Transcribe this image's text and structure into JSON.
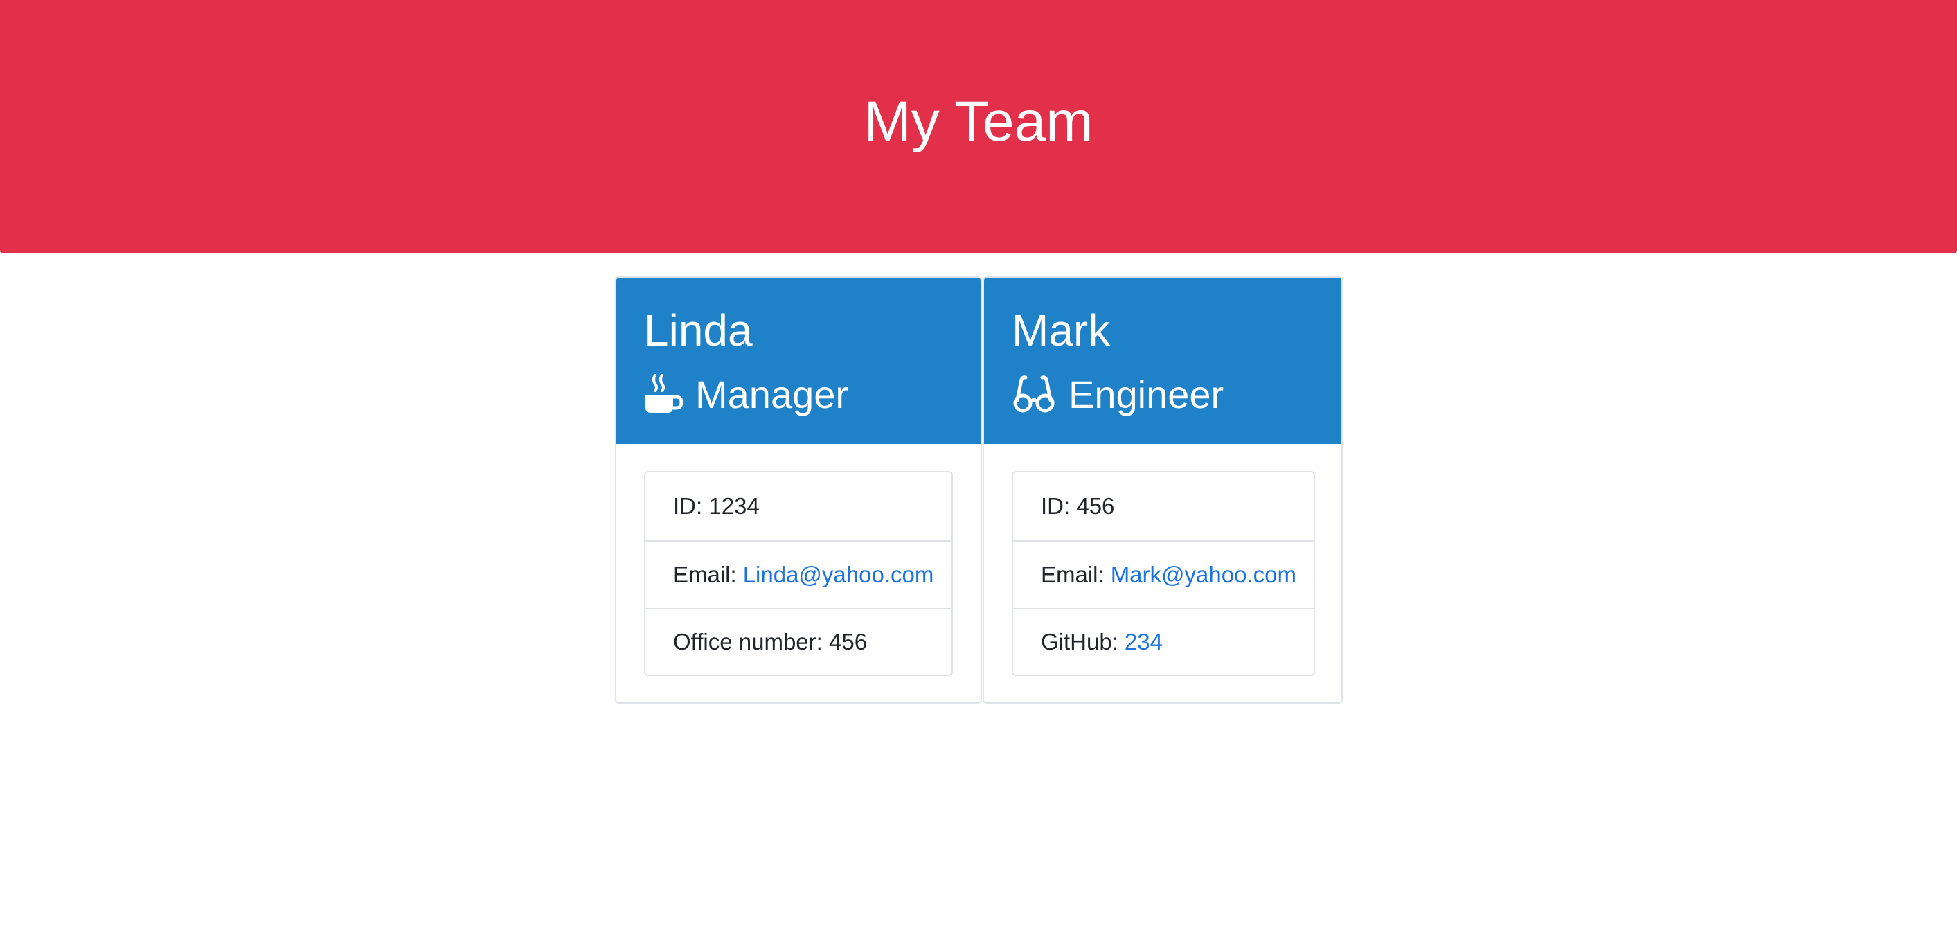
{
  "header": {
    "title": "My Team",
    "background_color": "#e3304a"
  },
  "cards": [
    {
      "name": "Linda",
      "role": "Manager",
      "role_icon": "coffee-mug-icon",
      "id_label": "ID: 1234",
      "email_label": "Email:",
      "email": "Linda@yahoo.com",
      "extra_label": "Office number: 456"
    },
    {
      "name": "Mark",
      "role": "Engineer",
      "role_icon": "glasses-icon",
      "id_label": "ID: 456",
      "email_label": "Email:",
      "email": "Mark@yahoo.com",
      "extra_label": "GitHub:",
      "extra_link": "234"
    }
  ],
  "colors": {
    "card_header": "#1f81c8",
    "link": "#1a73e0",
    "border": "#dfe2e6"
  }
}
